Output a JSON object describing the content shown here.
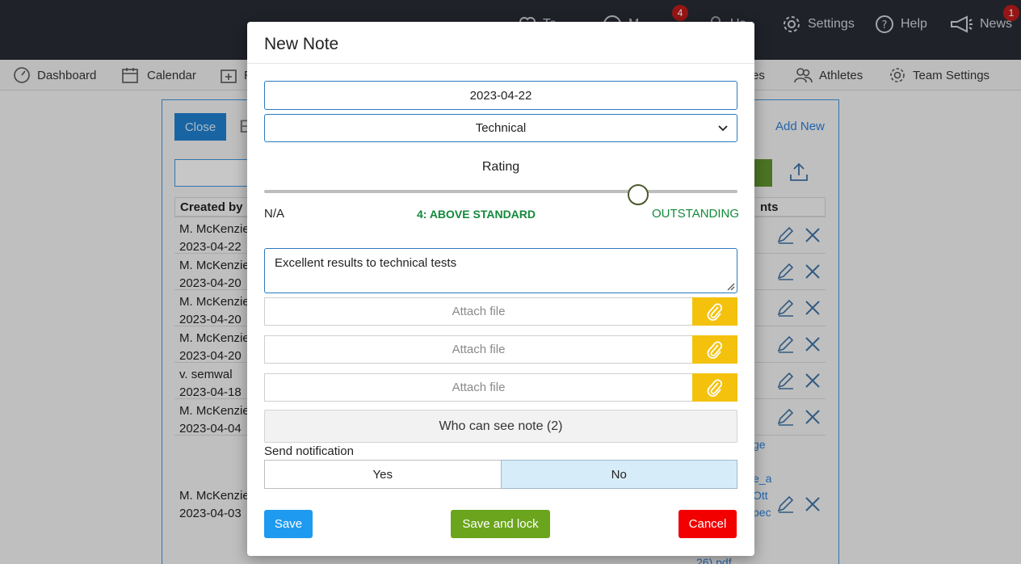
{
  "topbar": {
    "items": [
      {
        "label": "Te",
        "icon": "heart-icon"
      },
      {
        "label": "M",
        "icon": "chat-icon",
        "badge": "4"
      },
      {
        "label": "Us",
        "icon": "user-icon"
      },
      {
        "label": "Settings",
        "icon": "gear-icon"
      },
      {
        "label": "Help",
        "icon": "help-icon"
      },
      {
        "label": "News",
        "icon": "megaphone-icon",
        "badge": "1"
      }
    ]
  },
  "navbar": {
    "items": [
      {
        "label": "Dashboard",
        "icon": "dashboard-icon"
      },
      {
        "label": "Calendar",
        "icon": "calendar-icon"
      },
      {
        "label": "R",
        "icon": "medical-icon"
      },
      {
        "label": "res",
        "icon": "scores-icon"
      },
      {
        "label": "Athletes",
        "icon": "athletes-icon"
      },
      {
        "label": "Team Settings",
        "icon": "gear-icon"
      }
    ]
  },
  "background": {
    "close_label": "Close",
    "title_initial": "E",
    "add_new_label": "Add New",
    "table_header_created_by": "Created by",
    "table_header_attachments": "nts",
    "rows": [
      {
        "name": "M. McKenzie",
        "date": "2023-04-22"
      },
      {
        "name": "M. McKenzie",
        "date": "2023-04-20"
      },
      {
        "name": "M. McKenzie",
        "date": "2023-04-20"
      },
      {
        "name": "M. McKenzie",
        "date": "2023-04-20"
      },
      {
        "name": "v. semwal",
        "date": "2023-04-18"
      },
      {
        "name": "M. McKenzie",
        "date": "2023-04-04"
      },
      {
        "name": "M. McKenzie",
        "date": "2023-04-03"
      }
    ],
    "link_fragments": [
      "ge",
      "e_a",
      "Ott",
      "pec",
      "26).pdf"
    ]
  },
  "modal": {
    "title": "New Note",
    "date_value": "2023-04-22",
    "category_value": "Technical",
    "rating": {
      "label": "Rating",
      "min_label": "N/A",
      "current_label": "4: ABOVE STANDARD",
      "max_label": "OUTSTANDING",
      "value_fraction": 0.79
    },
    "note_text": "Excellent results to technical tests",
    "attachments": [
      {
        "placeholder": "Attach file"
      },
      {
        "placeholder": "Attach file"
      },
      {
        "placeholder": "Attach file"
      }
    ],
    "visibility_label": "Who can see note (2)",
    "notification": {
      "label": "Send notification",
      "yes_label": "Yes",
      "no_label": "No",
      "selected": "No"
    },
    "buttons": {
      "save": "Save",
      "save_and_lock": "Save and lock",
      "cancel": "Cancel"
    }
  },
  "colors": {
    "primary": "#1e9bf0",
    "success": "#6aa51d",
    "danger": "#f20000",
    "attach": "#f4c20d",
    "rating_text": "#128a3a"
  }
}
